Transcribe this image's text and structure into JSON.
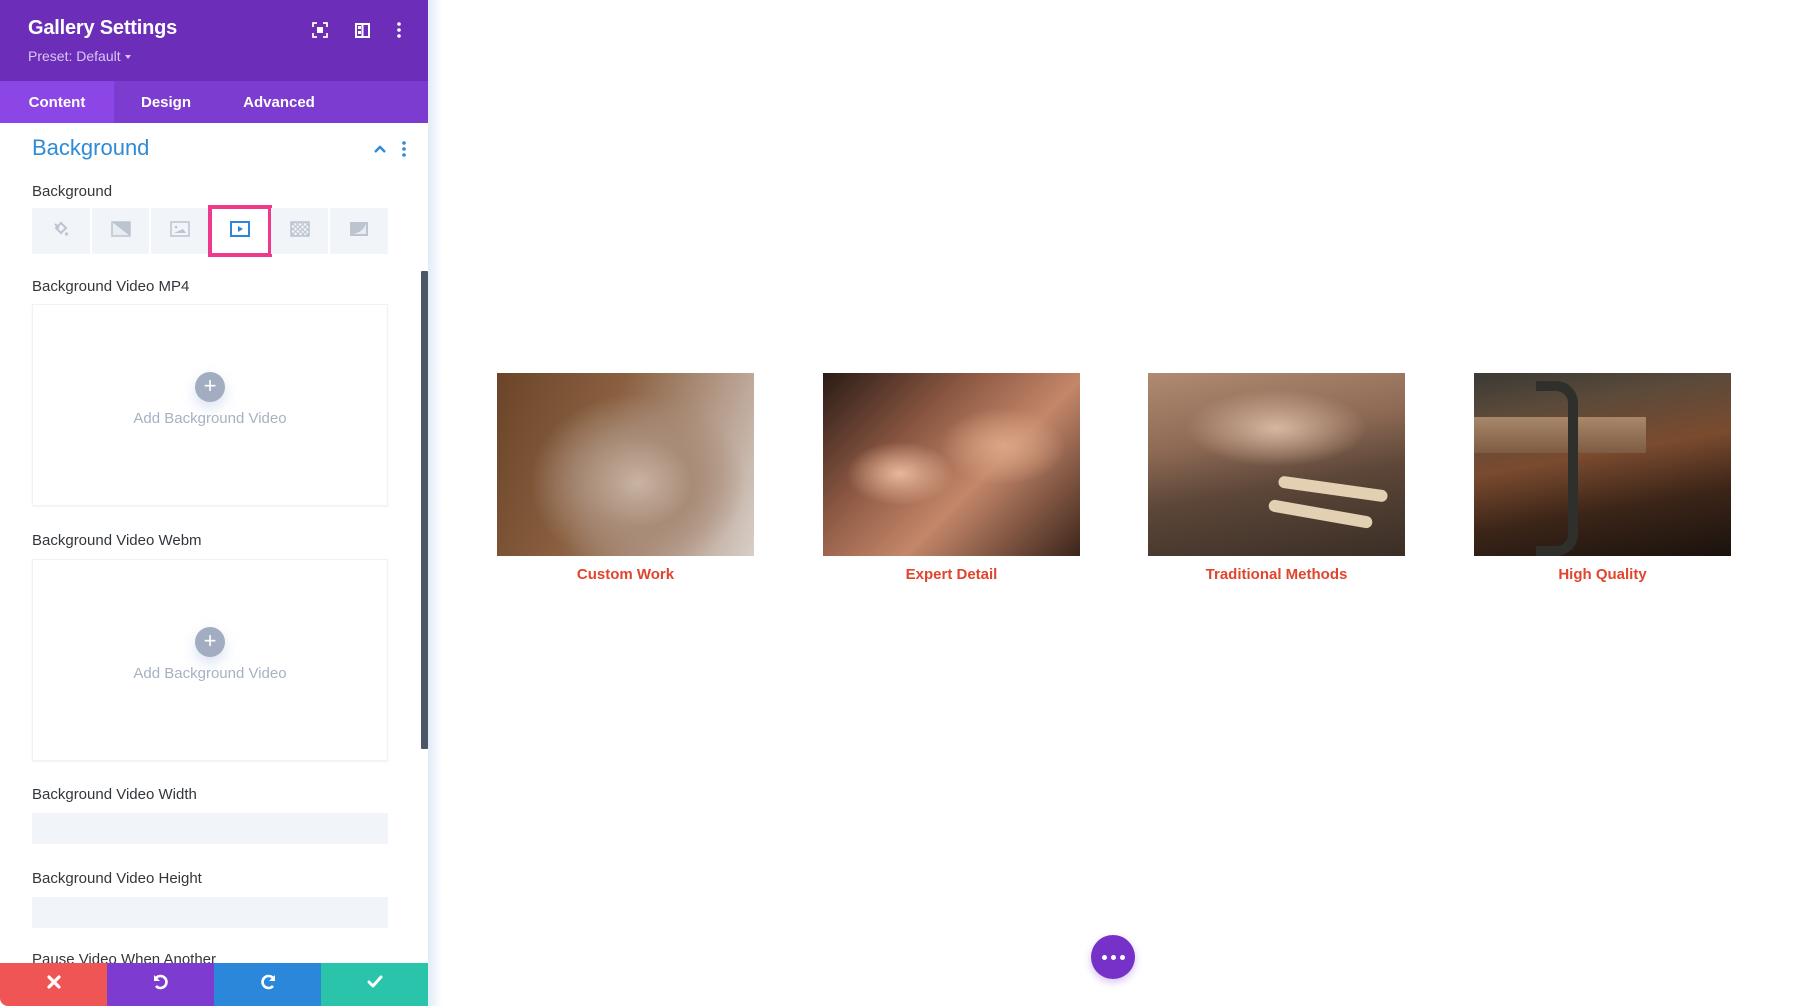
{
  "panel": {
    "title": "Gallery Settings",
    "preset_label": "Preset: Default",
    "header_icons": [
      "focus-mode-icon",
      "split-view-icon",
      "more-options-icon"
    ],
    "tabs": [
      {
        "label": "Content",
        "active": true
      },
      {
        "label": "Design",
        "active": false
      },
      {
        "label": "Advanced",
        "active": false
      }
    ],
    "section": {
      "title": "Background",
      "expanded": true
    },
    "background_field": {
      "label": "Background",
      "types": [
        {
          "name": "color",
          "icon": "paint-bucket-icon",
          "active": false
        },
        {
          "name": "gradient",
          "icon": "gradient-icon",
          "active": false
        },
        {
          "name": "image",
          "icon": "image-icon",
          "active": false
        },
        {
          "name": "video",
          "icon": "video-icon",
          "active": true
        },
        {
          "name": "pattern",
          "icon": "pattern-icon",
          "active": false
        },
        {
          "name": "mask",
          "icon": "mask-icon",
          "active": false
        }
      ]
    },
    "video_mp4": {
      "label": "Background Video MP4",
      "button": "Add Background Video"
    },
    "video_webm": {
      "label": "Background Video Webm",
      "button": "Add Background Video"
    },
    "video_width": {
      "label": "Background Video Width",
      "value": ""
    },
    "video_height": {
      "label": "Background Video Height",
      "value": ""
    },
    "pause_video_label": "Pause Video When Another",
    "footer": {
      "cancel": "close-icon",
      "undo": "undo-icon",
      "redo": "redo-icon",
      "save": "check-icon"
    },
    "colors": {
      "header": "#6c2eb9",
      "tabbar": "#7b3ccf",
      "active_tab": "#8c46e6",
      "section_title": "#2e8bd6",
      "highlight": "#ee3a8c",
      "cancel": "#ef5555",
      "undo": "#7e3bd0",
      "redo": "#2b87da",
      "save": "#29c4a9"
    }
  },
  "gallery": {
    "items": [
      {
        "caption": "Custom Work"
      },
      {
        "caption": "Expert Detail"
      },
      {
        "caption": "Traditional Methods"
      },
      {
        "caption": "High Quality"
      }
    ],
    "caption_color": "#e0452e"
  },
  "fab": {
    "icon": "more-dots-icon",
    "color": "#7631c9"
  }
}
